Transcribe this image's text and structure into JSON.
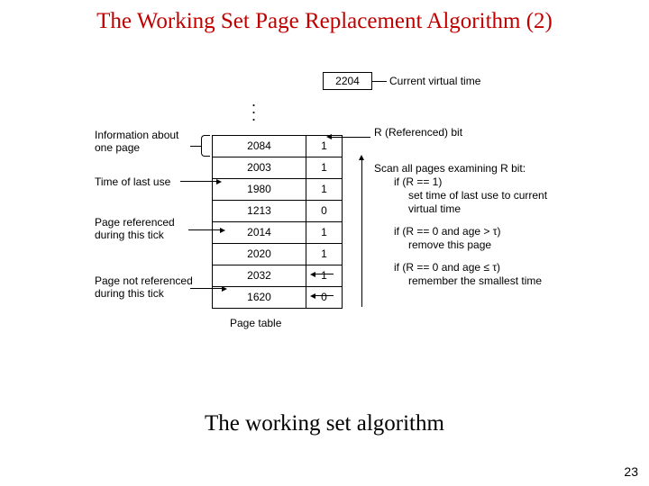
{
  "title": "The Working Set Page Replacement Algorithm (2)",
  "caption": "The working set algorithm",
  "page_number": "23",
  "diagram": {
    "current_virtual_time": {
      "value": "2204",
      "label": "Current virtual time"
    },
    "r_bit_label": "R (Referenced) bit",
    "page_table_label": "Page table",
    "info_label": "Information about\none page",
    "time_of_last_use_label": "Time of last use",
    "page_referenced_label": "Page referenced\nduring this tick",
    "page_not_referenced_label": "Page not referenced\nduring this tick",
    "rows": [
      {
        "time": "2084",
        "r": "1"
      },
      {
        "time": "2003",
        "r": "1"
      },
      {
        "time": "1980",
        "r": "1"
      },
      {
        "time": "1213",
        "r": "0"
      },
      {
        "time": "2014",
        "r": "1"
      },
      {
        "time": "2020",
        "r": "1"
      },
      {
        "time": "2032",
        "r": "1"
      },
      {
        "time": "1620",
        "r": "0"
      }
    ],
    "scan": {
      "head": "Scan all pages examining R bit:",
      "c1": "if (R == 1)",
      "c1a": "set time of last use to current virtual time",
      "c2": "if (R == 0 and age > τ)",
      "c2a": "remove this page",
      "c3": "if (R == 0 and age ≤ τ)",
      "c3a": "remember the smallest time"
    }
  }
}
